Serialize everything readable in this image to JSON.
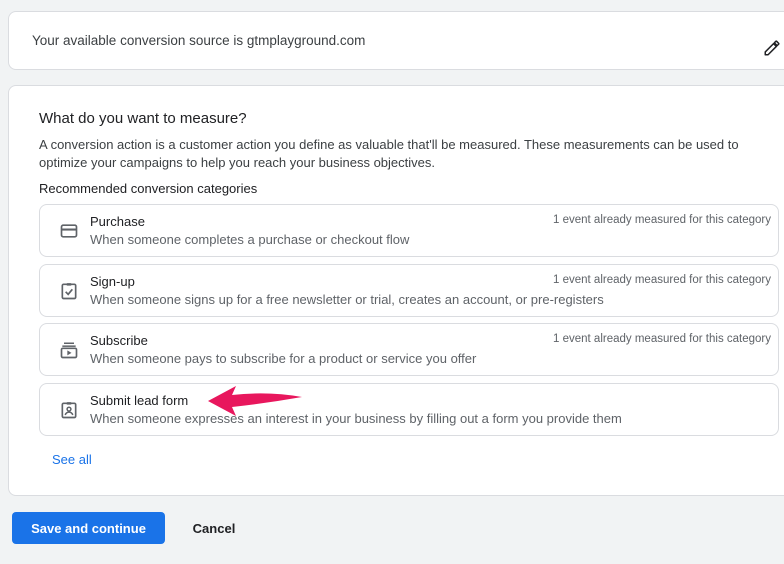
{
  "source_card": {
    "text": "Your available conversion source is gtmplayground.com",
    "edit_icon": "pencil-icon"
  },
  "measure": {
    "heading": "What do you want to measure?",
    "description": "A conversion action is a customer action you define as valuable that'll be measured. These measurements can be used to optimize your campaigns to help you reach your business objectives.",
    "recommended_label": "Recommended conversion categories",
    "categories": [
      {
        "title": "Purchase",
        "description": "When someone completes a purchase or checkout flow",
        "note": "1 event already measured for this category",
        "icon": "credit-card-icon"
      },
      {
        "title": "Sign-up",
        "description": "When someone signs up for a free newsletter or trial, creates an account, or pre-registers",
        "note": "1 event already measured for this category",
        "icon": "clipboard-check-icon"
      },
      {
        "title": "Subscribe",
        "description": "When someone pays to subscribe for a product or service you offer",
        "note": "1 event already measured for this category",
        "icon": "subscriptions-icon"
      },
      {
        "title": "Submit lead form",
        "description": "When someone expresses an interest in your business by filling out a form you provide them",
        "note": "",
        "icon": "contact-form-icon"
      }
    ],
    "see_all": "See all"
  },
  "actions": {
    "save_label": "Save and continue",
    "cancel_label": "Cancel"
  },
  "colors": {
    "primary": "#1a73e8",
    "arrow": "#e8175d",
    "icon": "#5f6368"
  }
}
